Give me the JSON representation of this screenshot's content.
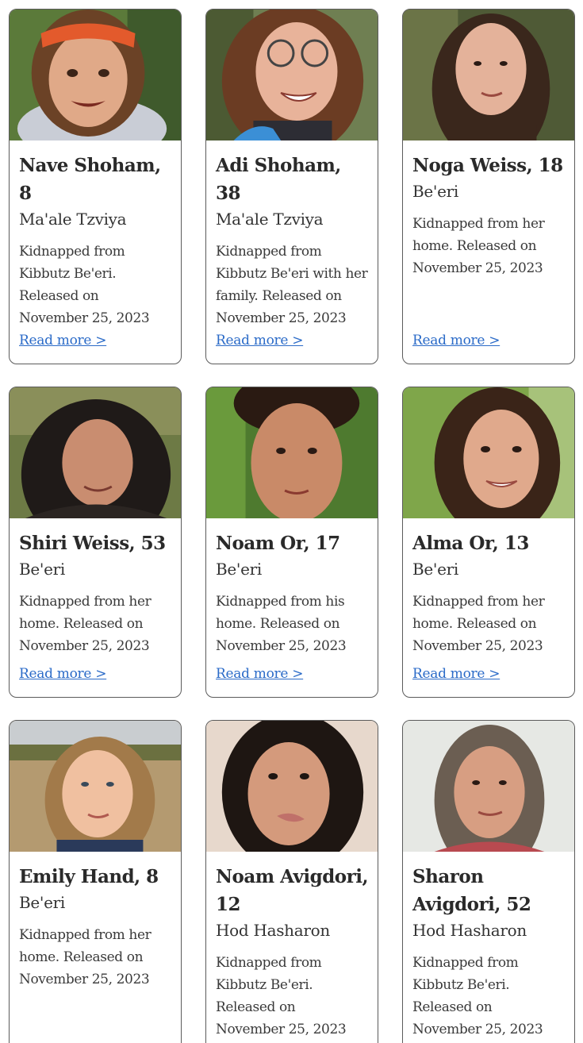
{
  "cards": [
    {
      "name": "Nave Shoham, 8",
      "place": "Ma'ale Tzviya",
      "description": "Kidnapped from Kibbutz Be'eri. Released on November 25, 2023",
      "link": "Read more >"
    },
    {
      "name": "Adi Shoham, 38",
      "place": "Ma'ale Tzviya",
      "description": "Kidnapped from Kibbutz Be'eri with her family. Released on November 25, 2023",
      "link": "Read more >"
    },
    {
      "name": "Noga Weiss, 18",
      "place": "Be'eri",
      "description": "Kidnapped from her home. Released on November 25, 2023",
      "link": "Read more >"
    },
    {
      "name": "Shiri Weiss, 53",
      "place": "Be'eri",
      "description": "Kidnapped from her home. Released on November 25, 2023",
      "link": "Read more >"
    },
    {
      "name": "Noam Or, 17",
      "place": "Be'eri",
      "description": "Kidnapped from his home. Released on November 25, 2023",
      "link": "Read more >"
    },
    {
      "name": "Alma Or, 13",
      "place": "Be'eri",
      "description": "Kidnapped from her home. Released on November 25, 2023",
      "link": "Read more >"
    },
    {
      "name": "Emily Hand, 8",
      "place": "Be'eri",
      "description": "Kidnapped from her home. Released on November 25, 2023"
    },
    {
      "name": "Noam Avigdori, 12",
      "place": "Hod Hasharon",
      "description": "Kidnapped from Kibbutz Be'eri. Released on November 25, 2023"
    },
    {
      "name": "Sharon Avigdori, 52",
      "place": "Hod Hasharon",
      "description": "Kidnapped from Kibbutz Be'eri. Released on November 25, 2023"
    }
  ]
}
